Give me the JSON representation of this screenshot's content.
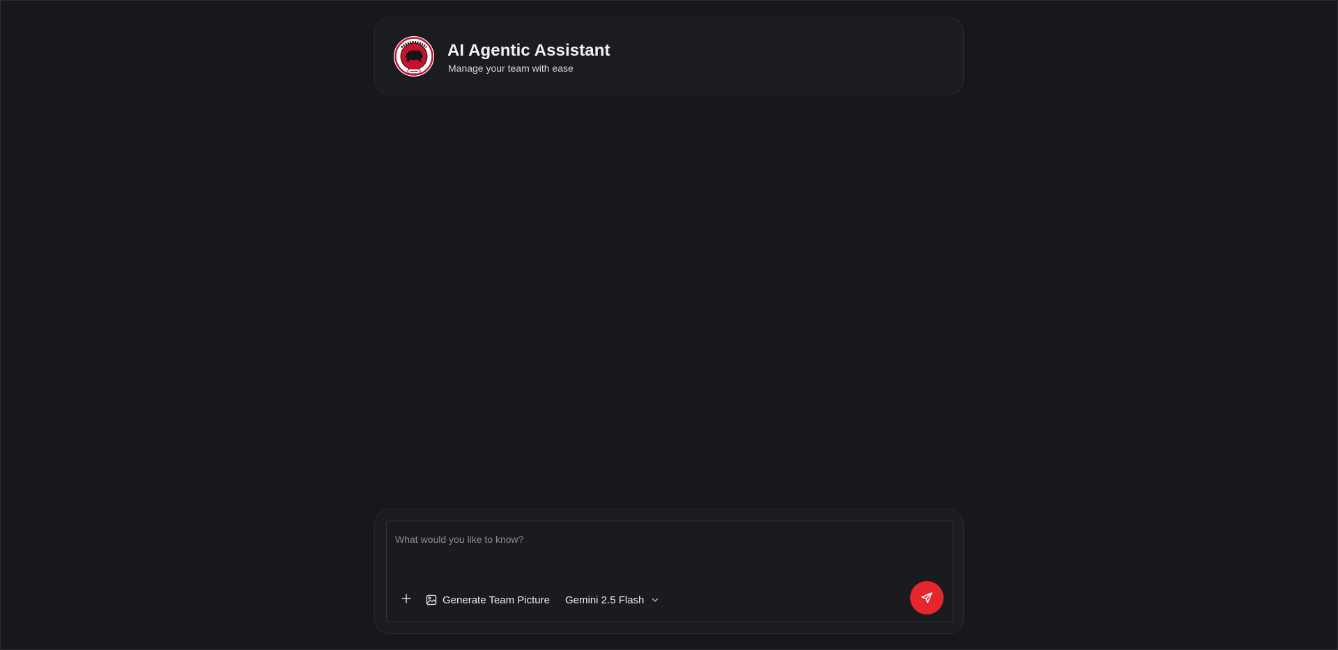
{
  "header": {
    "title": "AI Agentic Assistant",
    "subtitle": "Manage your team with ease",
    "logo_icon": "gorillas-team-logo",
    "logo_text": "GORILLAS"
  },
  "composer": {
    "placeholder": "What would you like to know?",
    "value": "",
    "add_icon": "plus-icon",
    "generate_label": "Generate Team Picture",
    "generate_icon": "image-icon",
    "model_selected": "Gemini 2.5 Flash",
    "model_icon": "chevron-down-icon",
    "send_icon": "send-icon"
  },
  "colors": {
    "background": "#17181c",
    "card": "#1b1c20",
    "accent": "#e5262c"
  }
}
